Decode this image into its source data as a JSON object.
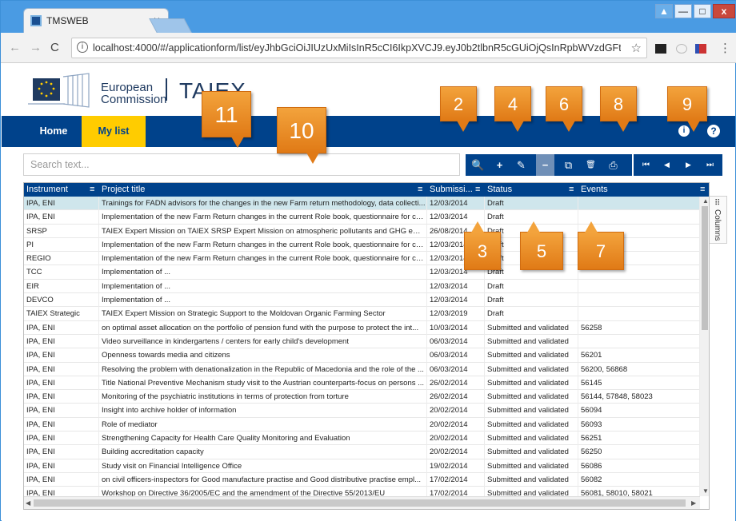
{
  "browser": {
    "tab_title": "TMSWEB",
    "tab_close": "×",
    "url": "localhost:4000/#/applicationform/list/eyJhbGciOiJIUzUxMiIsInR5cCI6IkpXVCJ9.eyJ0b2tlbnR5cGUiOjQsInRpbWVzdGFtcCI6MTU2MTk4NT...",
    "window_controls": {
      "user": "▲",
      "minimize": "—",
      "maximize": "□",
      "close": "x"
    }
  },
  "header": {
    "brand_line1": "European",
    "brand_line2": "Commission",
    "app_name": "TAIEX"
  },
  "nav": {
    "home": "Home",
    "mylist": "My list",
    "info_icon": "i",
    "help_icon": "?"
  },
  "search": {
    "placeholder": "Search text..."
  },
  "grid": {
    "columns": [
      {
        "label": "Instrument"
      },
      {
        "label": "Project title"
      },
      {
        "label": "Submissi..."
      },
      {
        "label": "Status"
      },
      {
        "label": "Events"
      }
    ],
    "column_menu_icon": "≡",
    "rows": [
      [
        "IPA, ENI",
        "Trainings for FADN advisors for the changes in the new Farm return methodology, data collecti...",
        "12/03/2014",
        "Draft",
        ""
      ],
      [
        "IPA, ENI",
        "Implementation of the new Farm Return changes in the current Role book, questionnaire for col...",
        "12/03/2014",
        "Draft",
        ""
      ],
      [
        "SRSP",
        "TAIEX Expert Mission on TAIEX SRSP Expert Mission on atmospheric pollutants and GHG emis...",
        "26/08/2014",
        "Draft",
        ""
      ],
      [
        "PI",
        "Implementation of the new Farm Return changes in the current Role book, questionnaire for col...",
        "12/03/2014",
        "Draft",
        ""
      ],
      [
        "REGIO",
        "Implementation of the new Farm Return changes in the current Role book, questionnaire for col...",
        "12/03/2014",
        "Draft",
        ""
      ],
      [
        "TCC",
        "Implementation of ...",
        "12/03/2014",
        "Draft",
        ""
      ],
      [
        "EIR",
        "Implementation of ...",
        "12/03/2014",
        "Draft",
        ""
      ],
      [
        "DEVCO",
        "Implementation of ...",
        "12/03/2014",
        "Draft",
        ""
      ],
      [
        "TAIEX Strategic",
        "TAIEX Expert Mission on Strategic Support to the Moldovan Organic Farming Sector",
        "12/03/2019",
        "Draft",
        ""
      ],
      [
        "IPA, ENI",
        "on optimal asset allocation on the portfolio of pension fund with the purpose to protect the int...",
        "10/03/2014",
        "Submitted and validated",
        "56258"
      ],
      [
        "IPA, ENI",
        "Video surveillance in kindergartens / centers for early child's development",
        "06/03/2014",
        "Submitted and validated",
        ""
      ],
      [
        "IPA, ENI",
        "Openness towards media and citizens",
        "06/03/2014",
        "Submitted and validated",
        "56201"
      ],
      [
        "IPA, ENI",
        "Resolving the problem with denationalization in the Republic of Macedonia and the role of the ...",
        "06/03/2014",
        "Submitted and validated",
        "56200, 56868"
      ],
      [
        "IPA, ENI",
        "Title National Preventive Mechanism study visit to the Austrian counterparts-focus on persons ...",
        "26/02/2014",
        "Submitted and validated",
        "56145"
      ],
      [
        "IPA, ENI",
        "Monitoring of the psychiatric institutions in terms of protection from torture",
        "26/02/2014",
        "Submitted and validated",
        "56144, 57848, 58023"
      ],
      [
        "IPA, ENI",
        "Insight into archive holder of information",
        "20/02/2014",
        "Submitted and validated",
        "56094"
      ],
      [
        "IPA, ENI",
        "Role of mediator",
        "20/02/2014",
        "Submitted and validated",
        "56093"
      ],
      [
        "IPA, ENI",
        "Strengthening Capacity for Health Care Quality Monitoring and Evaluation",
        "20/02/2014",
        "Submitted and validated",
        "56251"
      ],
      [
        "IPA, ENI",
        "Building accreditation capacity",
        "20/02/2014",
        "Submitted and validated",
        "56250"
      ],
      [
        "IPA, ENI",
        "Study visit on Financial Intelligence Office",
        "19/02/2014",
        "Submitted and validated",
        "56086"
      ],
      [
        "IPA, ENI",
        "on civil officers-inspectors for Good manufacture practise and Good distributive practise empl...",
        "17/02/2014",
        "Submitted and validated",
        "56082"
      ],
      [
        "IPA, ENI",
        "Workshop on Directive 36/2005/EC and the amendment of the Directive 55/2013/EU",
        "17/02/2014",
        "Submitted and validated",
        "56081, 58010, 58021"
      ]
    ]
  },
  "columns_panel": {
    "label": "Columns",
    "icon": "⠿"
  },
  "toolbar_icons": {
    "search": "🔍",
    "add": "+",
    "edit": "✎",
    "remove": "−",
    "copy": "⧉",
    "delete": "🗑",
    "print": "⎙",
    "first": "⏮",
    "prev": "◀",
    "next": "▶",
    "last": "⏭"
  },
  "callouts": [
    "2",
    "4",
    "6",
    "8",
    "9",
    "11",
    "10",
    "3",
    "5",
    "7"
  ],
  "colors": {
    "nav_blue": "#00428b",
    "accent_yellow": "#ffcc00",
    "callout_orange": "#e07a16",
    "selected_row": "#cfe6ec"
  }
}
